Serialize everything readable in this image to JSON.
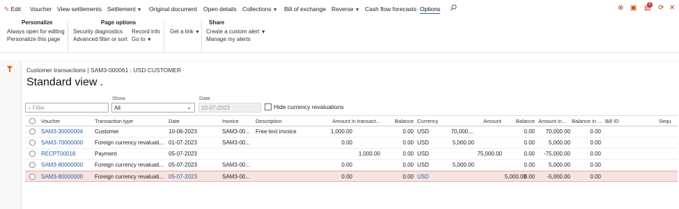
{
  "menu": {
    "edit": "Edit",
    "voucher": "Voucher",
    "view_settlements": "View settlements",
    "settlement": "Settlement",
    "original_document": "Original document",
    "open_details": "Open details",
    "collections": "Collections",
    "bill_of_exchange": "Bill of exchange",
    "reverse": "Reverse",
    "cash_flow_forecasts": "Cash flow forecasts",
    "options": "Options",
    "badge": "0"
  },
  "ribbon": {
    "personalize": {
      "title": "Personalize",
      "items": [
        "Always open for editing",
        "Personalize this page"
      ]
    },
    "page_options": {
      "title": "Page options",
      "items": [
        "Security diagnostics",
        "Advanced filter or sort",
        "Record info",
        "Go to"
      ]
    },
    "get_a_link": "Get a link",
    "share": {
      "title": "Share",
      "items": [
        "Create a custom alert",
        "Manage my alerts"
      ]
    }
  },
  "page": {
    "breadcrumb": "Customer transactions  |  SAM3-000061 : USD CUSTOMER",
    "view_title": "Standard view",
    "filter_placeholder": "Filter",
    "show_label": "Show",
    "show_value": "All",
    "date_label": "Date",
    "date_value": "10-07-2023",
    "hide_reval_label": "Hide currency revaluations"
  },
  "grid": {
    "columns": [
      "Voucher",
      "Transaction type",
      "Date",
      "Invoice",
      "Description",
      "Amount in transact...",
      "Balance",
      "Currency",
      "Amount",
      "Balance",
      "Amount in...",
      "Balance in ...",
      "Bill ID",
      "Sequ"
    ],
    "rows": [
      [
        "SAM3-30000004",
        "Customer",
        "10-06-2023",
        "SAM3-00...",
        "Free text invoice",
        "1,000.00",
        "",
        "0.00",
        "USD",
        "70,000....",
        "",
        "0.00",
        "70,000.00",
        "0.00"
      ],
      [
        "SAM3-70000000",
        "Foreign currency revaluati...",
        "01-07-2023",
        "SAM3-00...",
        "",
        "0.00",
        "",
        "0.00",
        "USD",
        "5,000.00",
        "",
        "0.00",
        "5,000.00",
        "0.00"
      ],
      [
        "RECPT00018",
        "Payment",
        "05-07-2023",
        "",
        "",
        "",
        "1,000.00",
        "0.00",
        "USD",
        "",
        "75,000.00",
        "0.00",
        "-75,000.00",
        "0.00"
      ],
      [
        "SAM3-80000000",
        "Foreign currency revaluati...",
        "05-07-2023",
        "SAM3-00...",
        "",
        "0.00",
        "",
        "0.00",
        "USD",
        "5,000.00",
        "",
        "0.00",
        "5,000.00",
        "0.00"
      ],
      [
        "SAM3-80000000",
        "Foreign currency revaluati...",
        "05-07-2023",
        "SAM3-00...",
        "",
        "0.00",
        "",
        "0.00",
        "USD",
        "",
        "5,000.00",
        "0.00",
        "-5,000.00",
        "0.00"
      ]
    ]
  }
}
